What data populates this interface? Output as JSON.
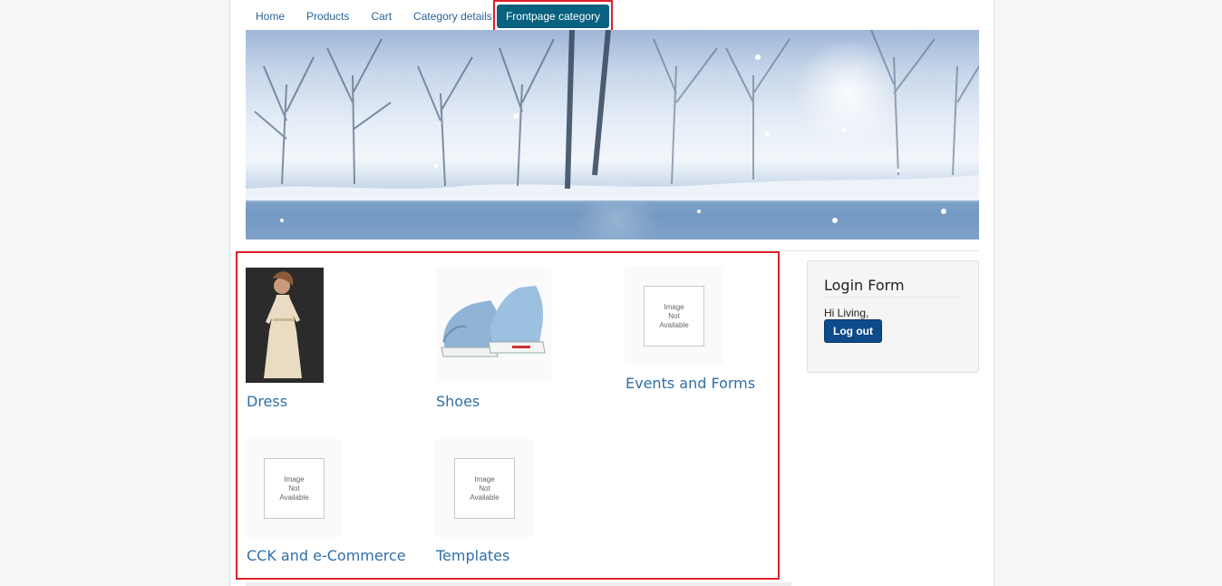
{
  "nav": {
    "items": [
      "Home",
      "Products",
      "Cart",
      "Category details"
    ],
    "active": "Frontpage category"
  },
  "categories": [
    {
      "title": "Dress",
      "image": "dress-photo"
    },
    {
      "title": "Shoes",
      "image": "shoes-photo"
    },
    {
      "title": "Events and Forms",
      "image": "image-not-available"
    },
    {
      "title": "CCK and e-Commerce",
      "image": "image-not-available"
    },
    {
      "title": "Templates",
      "image": "image-not-available"
    }
  ],
  "placeholder": {
    "line1": "Image",
    "line2": "Not",
    "line3": "Available"
  },
  "login": {
    "title": "Login Form",
    "greeting": "Hi Living,",
    "logout_label": "Log out"
  },
  "colors": {
    "accent": "#08617f",
    "link": "#2f6fa7",
    "highlight": "#e0212c",
    "button": "#0d4a8a"
  }
}
